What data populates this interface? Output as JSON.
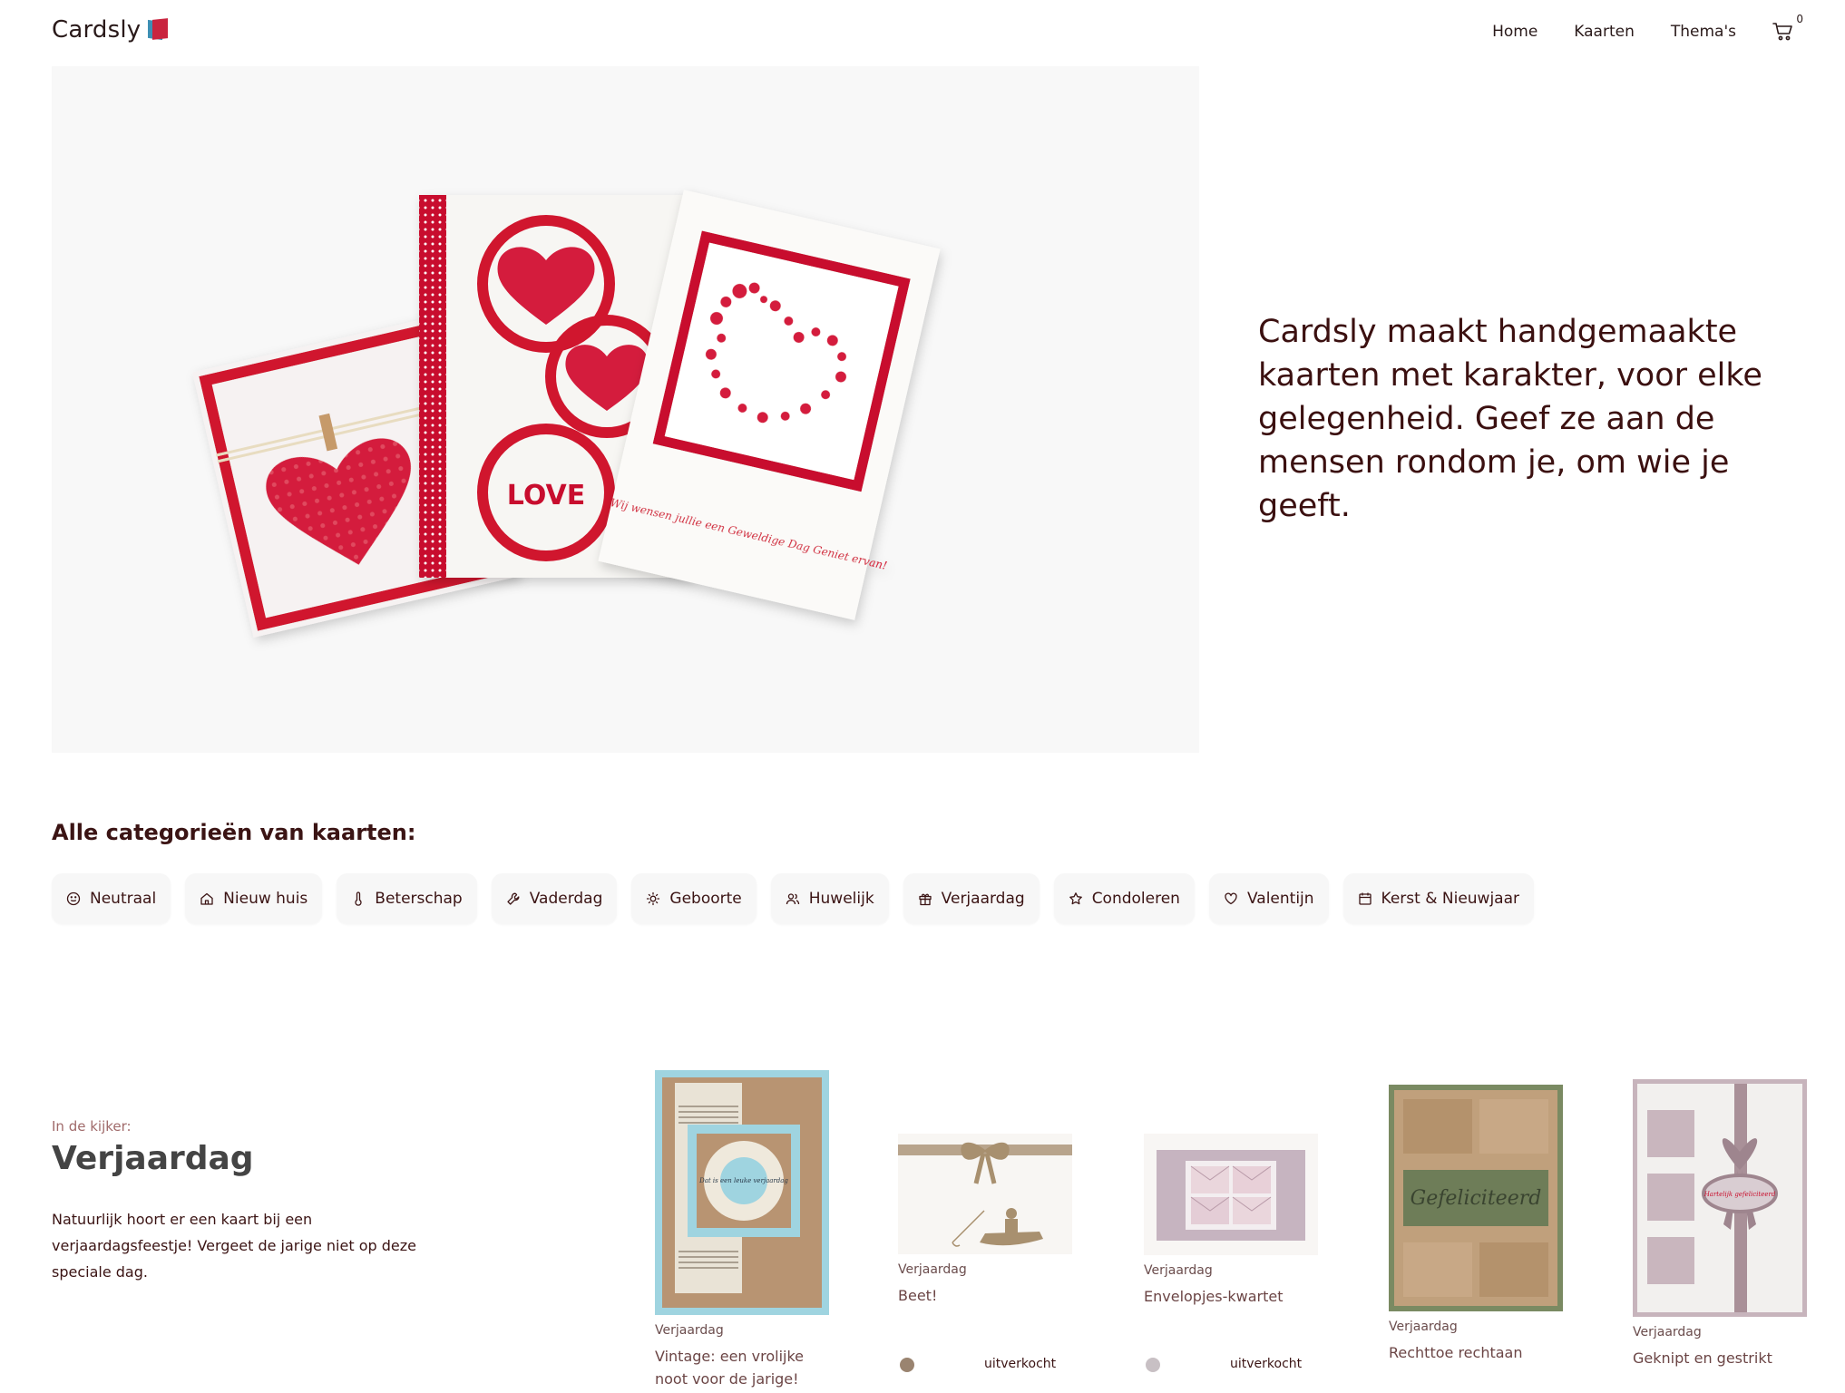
{
  "header": {
    "logo_text": "Cardsly",
    "nav": [
      "Home",
      "Kaarten",
      "Thema's"
    ],
    "cart_count": "0"
  },
  "hero": {
    "tagline": "Cardsly maakt handgemaakte kaarten met karakter, voor elke gelegenheid. Geef ze aan de mensen rondom je, om wie je geeft.",
    "card_love_text": "LOVE",
    "card_wish_text": "Wij wensen jullie een Geweldige Dag Geniet ervan!"
  },
  "categories": {
    "title": "Alle categorieën van kaarten:",
    "items": [
      {
        "label": "Neutraal",
        "icon": "smile-icon"
      },
      {
        "label": "Nieuw huis",
        "icon": "home-icon"
      },
      {
        "label": "Beterschap",
        "icon": "thermometer-icon"
      },
      {
        "label": "Vaderdag",
        "icon": "wrench-icon"
      },
      {
        "label": "Geboorte",
        "icon": "sun-icon"
      },
      {
        "label": "Huwelijk",
        "icon": "users-icon"
      },
      {
        "label": "Verjaardag",
        "icon": "gift-icon"
      },
      {
        "label": "Condoleren",
        "icon": "star-icon"
      },
      {
        "label": "Valentijn",
        "icon": "heart-icon"
      },
      {
        "label": "Kerst & Nieuwjaar",
        "icon": "calendar-icon"
      }
    ]
  },
  "featured": {
    "kicker": "In de kijker:",
    "title": "Verjaardag",
    "description": "Natuurlijk hoort er een kaart bij een verjaardagsfeestje! Vergeet de jarige niet op deze speciale dag.",
    "products": [
      {
        "category": "Verjaardag",
        "name": "Vintage: een vrolijke noot voor de jarige!",
        "status": "",
        "card_text": "Dat is een leuke verjaardag"
      },
      {
        "category": "Verjaardag",
        "name": "Beet!",
        "status": "uitverkocht",
        "dot_color": "#9a8470"
      },
      {
        "category": "Verjaardag",
        "name": "Envelopjes-kwartet",
        "status": "uitverkocht",
        "dot_color": "#c8c0c4"
      },
      {
        "category": "Verjaardag",
        "name": "Rechttoe rechtaan",
        "status": "",
        "card_text": "Gefeliciteerd"
      },
      {
        "category": "Verjaardag",
        "name": "Geknipt en gestrikt",
        "status": "",
        "card_text": "Hartelijk gefeliciteerd"
      }
    ]
  }
}
